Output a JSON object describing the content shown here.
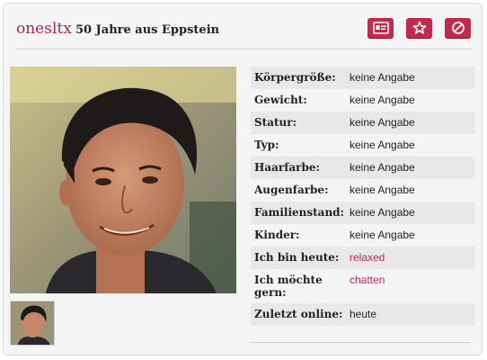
{
  "header": {
    "username": "onesltx",
    "subtitle": "50 Jahre aus Eppstein"
  },
  "actions": [
    {
      "icon": "profile-card-icon"
    },
    {
      "icon": "star-icon"
    },
    {
      "icon": "block-icon"
    }
  ],
  "colors": {
    "accent": "#c3284d",
    "username": "#a8264a",
    "row_alt": "#e8e8e8",
    "card_bg": "#f4f4f4"
  },
  "details": [
    {
      "label": "Körpergröße:",
      "value": "keine Angabe"
    },
    {
      "label": "Gewicht:",
      "value": "keine Angabe"
    },
    {
      "label": "Statur:",
      "value": "keine Angabe"
    },
    {
      "label": "Typ:",
      "value": "keine Angabe"
    },
    {
      "label": "Haarfarbe:",
      "value": "keine Angabe"
    },
    {
      "label": "Augenfarbe:",
      "value": "keine Angabe"
    },
    {
      "label": "Familienstand:",
      "value": "keine Angabe"
    },
    {
      "label": "Kinder:",
      "value": "keine Angabe"
    },
    {
      "label": "Ich bin heute:",
      "value": "relaxed"
    },
    {
      "label": "Ich möchte gern:",
      "value": "chatten"
    },
    {
      "label": "Zuletzt online:",
      "value": "heute"
    }
  ]
}
